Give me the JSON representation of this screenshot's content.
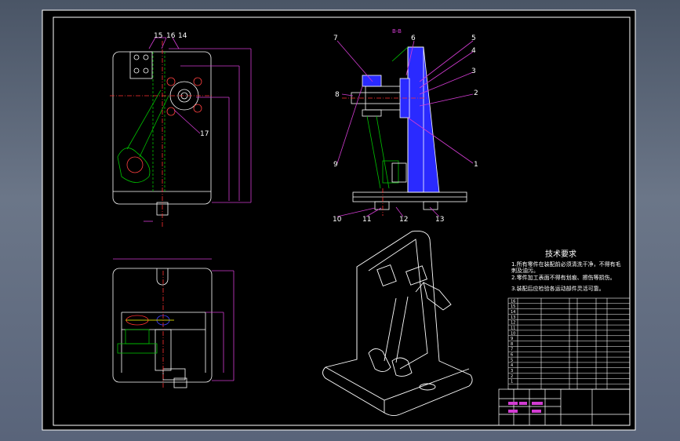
{
  "drawing": {
    "section_label": "B-B",
    "front_callouts": [
      "15",
      "16",
      "14",
      "17"
    ],
    "section_callouts": [
      "7",
      "6",
      "5",
      "4",
      "3",
      "8",
      "2",
      "9",
      "1",
      "10",
      "11",
      "12",
      "13"
    ],
    "tech_requirements": {
      "title": "技术要求",
      "lines": [
        "1.所有零件在装配前必须清洗干净，不得有毛",
        "刺及油污。",
        "2.零件加工表面不得有划痕、擦伤等损伤。",
        "3.装配后应检验各运动部件灵活可靠。"
      ]
    },
    "bom_rows": [
      "16",
      "15",
      "14",
      "13",
      "12",
      "11",
      "10",
      "9",
      "8",
      "7",
      "6",
      "5",
      "4",
      "3",
      "2",
      "1"
    ],
    "colors": {
      "frame_bg": "#000000",
      "line": "#ffffff",
      "dimension": "#d23cd2",
      "centerline": "#ff3030",
      "hidden": "#00c000",
      "hatch": "#4040ff",
      "highlight": "#ffff00"
    }
  }
}
